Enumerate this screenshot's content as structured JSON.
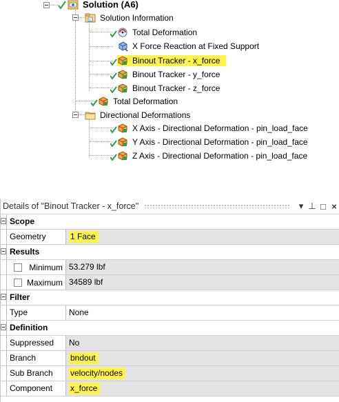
{
  "tree": {
    "root": "Solution (A6)",
    "solution_information": "Solution Information",
    "items_under_info": [
      "Total Deformation",
      "X Force Reaction at Fixed Support",
      "Binout Tracker - x_force",
      "Binout Tracker - y_force",
      "Binout Tracker - z_force"
    ],
    "total_deformation": "Total Deformation",
    "directional_folder": "Directional Deformations",
    "directional_items": [
      "X Axis - Directional Deformation - pin_load_face",
      "Y Axis - Directional Deformation - pin_load_face",
      "Z Axis - Directional Deformation - pin_load_face"
    ]
  },
  "details": {
    "title": "Details of \"Binout Tracker - x_force\"",
    "controls": {
      "dropdown": "▾",
      "pin": "⊥",
      "maximize": "□",
      "close": "×"
    },
    "scope": {
      "label": "Scope",
      "geometry_label": "Geometry",
      "geometry_value": "1 Face"
    },
    "results": {
      "label": "Results",
      "min_label": "Minimum",
      "min_value": "53.279 lbf",
      "max_label": "Maximum",
      "max_value": "34589 lbf"
    },
    "filter": {
      "label": "Filter",
      "type_label": "Type",
      "type_value": "None"
    },
    "definition": {
      "label": "Definition",
      "suppressed_label": "Suppressed",
      "suppressed_value": "No",
      "branch_label": "Branch",
      "branch_value": "bndout",
      "subbranch_label": "Sub Branch",
      "subbranch_value": "velocity/nodes",
      "component_label": "Component",
      "component_value": "x_force"
    }
  },
  "colors": {
    "highlight": "#fff34a",
    "check_green": "#2ea043",
    "value_bg": "#e4e4e4"
  }
}
